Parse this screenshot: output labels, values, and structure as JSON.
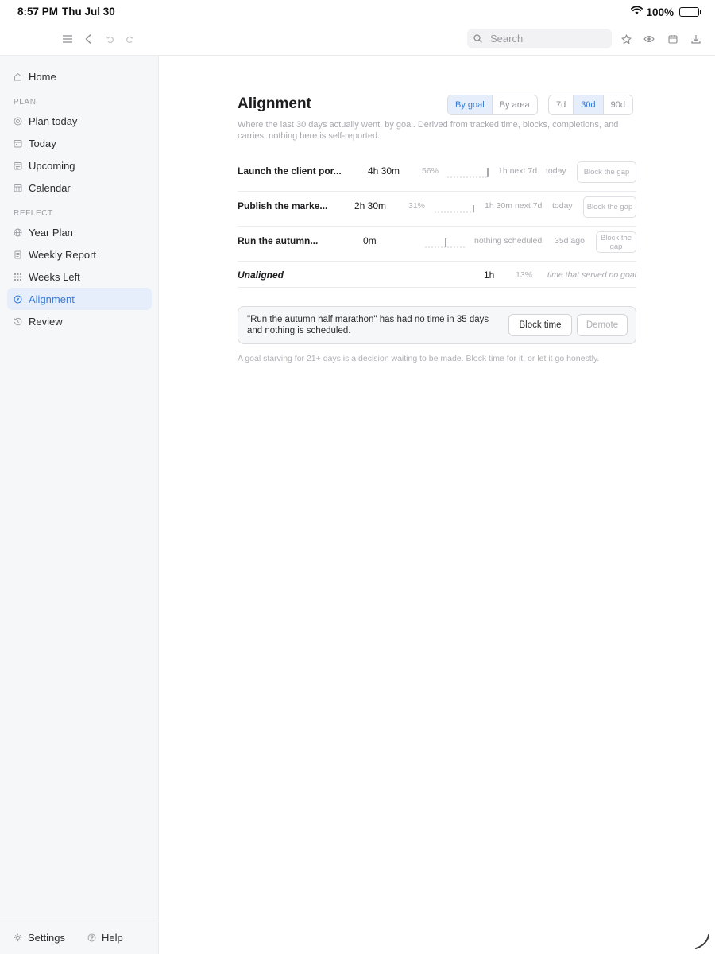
{
  "status_bar": {
    "time": "8:57 PM",
    "date": "Thu Jul 30",
    "battery": "100%"
  },
  "toolbar": {
    "search_placeholder": "Search"
  },
  "sidebar": {
    "home": "Home",
    "plan_section": "PLAN",
    "plan_items": [
      "Plan today",
      "Today",
      "Upcoming",
      "Calendar"
    ],
    "reflect_section": "REFLECT",
    "reflect_items": [
      "Year Plan",
      "Weekly Report",
      "Weeks Left",
      "Alignment",
      "Review"
    ],
    "active_item": "Alignment",
    "footer": {
      "settings": "Settings",
      "help": "Help"
    }
  },
  "main": {
    "title": "Alignment",
    "view_toggle": [
      "By goal",
      "By area"
    ],
    "view_selected": "By goal",
    "range_toggle": [
      "7d",
      "30d",
      "90d"
    ],
    "range_selected": "30d",
    "subtitle": "Where the last 30 days actually went, by goal. Derived from tracked time, blocks, completions, and carries; nothing here is self-reported.",
    "goals": [
      {
        "name": "Launch the client por...",
        "time": "4h 30m",
        "percent": "56%",
        "next": "1h next 7d",
        "last": "today",
        "action": "Block the gap"
      },
      {
        "name": "Publish the marke...",
        "time": "2h 30m",
        "percent": "31%",
        "next": "1h 30m next 7d",
        "last": "today",
        "action": "Block the gap"
      },
      {
        "name": "Run the autumn...",
        "time": "0m",
        "percent": "",
        "next": "nothing scheduled",
        "last": "35d ago",
        "action": "Block the gap"
      }
    ],
    "unaligned": {
      "name": "Unaligned",
      "time": "1h",
      "percent": "13%",
      "note": "time that served no goal"
    },
    "alert": {
      "text": "\"Run the autumn half marathon\" has had no time in 35 days and nothing is scheduled.",
      "primary": "Block time",
      "secondary": "Demote"
    },
    "footnote": "A goal starving for 21+ days is a decision waiting to be made. Block time for it, or let it go honestly."
  }
}
